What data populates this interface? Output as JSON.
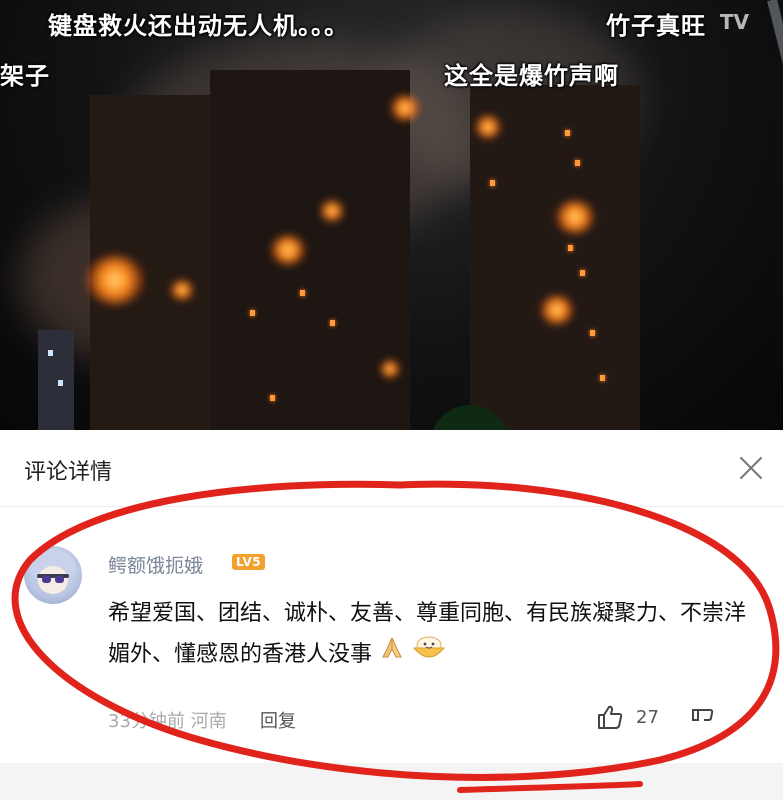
{
  "video": {
    "danmaku": [
      "键盘救火还出动无人机。。。",
      "竹子真旺",
      "架子",
      "这全是爆竹声啊"
    ],
    "watermark": "TV"
  },
  "comment_panel": {
    "title": "评论详情",
    "comment": {
      "username": "鳄额饿扼娥",
      "level_badge": "LV5",
      "text": "希望爱国、团结、诚朴、友善、尊重同胞、有民族凝聚力、不崇洋媚外、懂感恩的香港人没事",
      "emojis": [
        "pray-emoji",
        "bowl-emoji"
      ],
      "time_location": "33分钟前 河南",
      "reply_label": "回复",
      "like_count": "27"
    }
  },
  "colors": {
    "annotation_red": "#e0241b",
    "level_badge": "#f2a12e",
    "username": "#7a8598"
  }
}
